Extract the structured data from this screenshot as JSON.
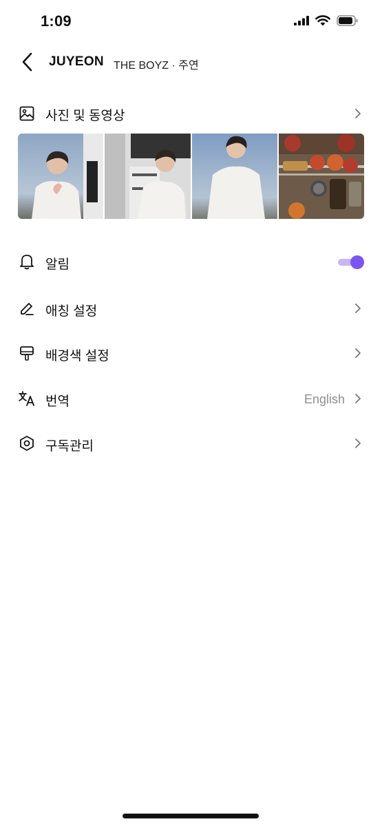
{
  "status_bar": {
    "time": "1:09"
  },
  "nav": {
    "title": "JUYEON",
    "subtitle": "THE BOYZ · 주연"
  },
  "media_section": {
    "label": "사진 및 동영상",
    "thumbnails": [
      "photo-1",
      "photo-2",
      "photo-3",
      "photo-4"
    ]
  },
  "settings": {
    "notifications": {
      "label": "알림",
      "enabled": true
    },
    "nickname": {
      "label": "애칭 설정"
    },
    "background_color": {
      "label": "배경색 설정"
    },
    "translation": {
      "label": "번역",
      "value": "English"
    },
    "subscription": {
      "label": "구독관리"
    }
  },
  "colors": {
    "accent": "#7b55f0",
    "accent_light": "#c8b6f5",
    "secondary_text": "#8e8e93"
  }
}
